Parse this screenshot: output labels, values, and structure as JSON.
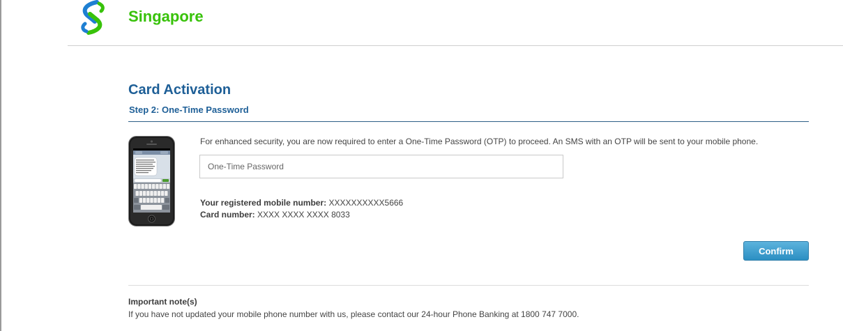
{
  "header": {
    "brand": "Singapore",
    "logo_icon": "standard-chartered-logo-icon",
    "brand_color": "#38c20a"
  },
  "page": {
    "title": "Card Activation",
    "step": "Step 2: One-Time Password",
    "title_color": "#1e5f97"
  },
  "otp": {
    "instructions": "For enhanced security, you are now required to enter a One-Time Password (OTP) to proceed. An SMS with an OTP will be sent to your mobile phone.",
    "placeholder": "One-Time Password",
    "value": "",
    "phone_icon": "phone-sms-icon"
  },
  "details": {
    "mobile_label": "Your registered mobile number:",
    "mobile_value": "XXXXXXXXXX5666",
    "card_label": "Card number:",
    "card_value": "XXXX XXXX XXXX 8033"
  },
  "actions": {
    "confirm_label": "Confirm",
    "confirm_color": "#2b8fc3"
  },
  "notes": {
    "title": "Important note(s)",
    "text": "If you have not updated your mobile phone number with us, please contact our 24-hour Phone Banking at 1800 747 7000."
  }
}
